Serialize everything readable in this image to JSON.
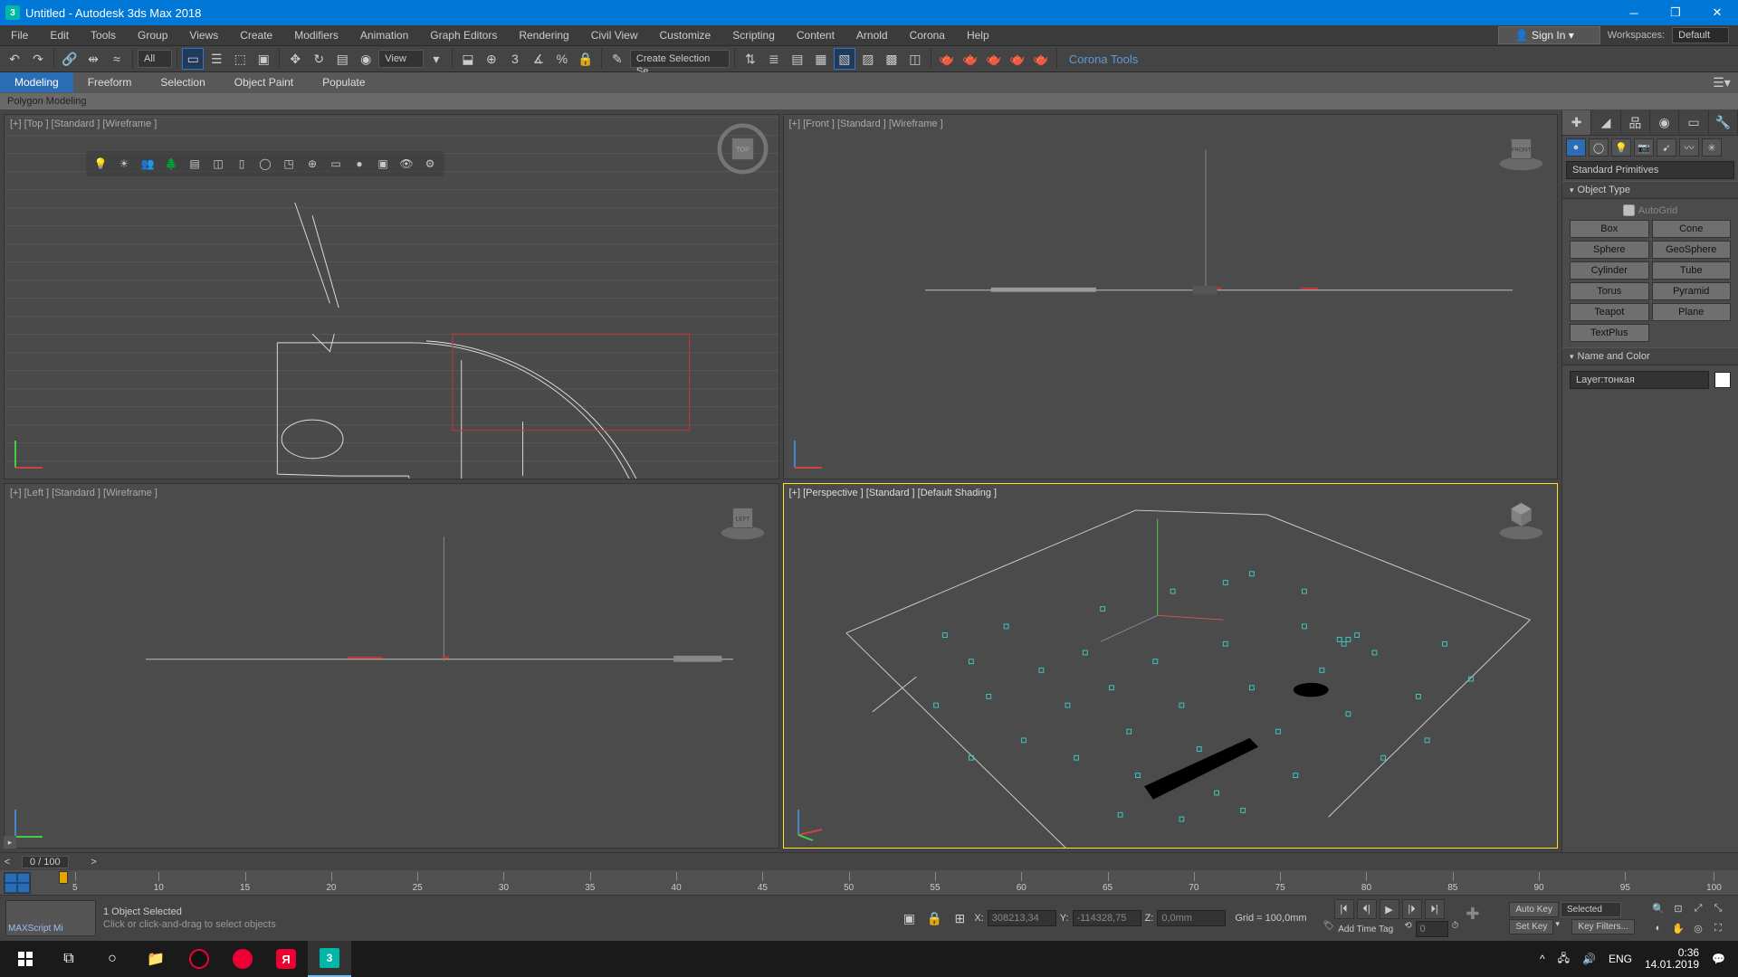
{
  "titlebar": {
    "title": "Untitled - Autodesk 3ds Max 2018"
  },
  "menu": [
    "File",
    "Edit",
    "Tools",
    "Group",
    "Views",
    "Create",
    "Modifiers",
    "Animation",
    "Graph Editors",
    "Rendering",
    "Civil View",
    "Customize",
    "Scripting",
    "Content",
    "Arnold",
    "Corona",
    "Help"
  ],
  "signin": "Sign In",
  "workspace": {
    "label": "Workspaces:",
    "value": "Default"
  },
  "toolbar": {
    "filter_all": "All",
    "view": "View",
    "create_sel": "Create Selection Se",
    "corona": "Corona Tools"
  },
  "ribbon": {
    "tabs": [
      "Modeling",
      "Freeform",
      "Selection",
      "Object Paint",
      "Populate"
    ],
    "sub": "Polygon Modeling"
  },
  "viewports": {
    "tl": "[+] [Top ] [Standard ] [Wireframe ]",
    "tr": "[+] [Front ] [Standard ] [Wireframe ]",
    "bl": "[+] [Left ] [Standard ] [Wireframe ]",
    "br": "[+] [Perspective ] [Standard ] [Default Shading ]"
  },
  "cmdpanel": {
    "category": "Standard Primitives",
    "rollout1": "Object Type",
    "autogrid": "AutoGrid",
    "objects": [
      "Box",
      "Cone",
      "Sphere",
      "GeoSphere",
      "Cylinder",
      "Tube",
      "Torus",
      "Pyramid",
      "Teapot",
      "Plane",
      "TextPlus"
    ],
    "rollout2": "Name and Color",
    "name_value": "Layer:тонкая"
  },
  "time": {
    "frame": "0 / 100",
    "marks": [
      5,
      10,
      15,
      20,
      25,
      30,
      35,
      40,
      45,
      50,
      55,
      60,
      65,
      70,
      75,
      80,
      85,
      90,
      95,
      100
    ]
  },
  "status": {
    "sel": "1 Object Selected",
    "hint": "Click or click-and-drag to select objects",
    "mx": "MAXScript Mi",
    "x": "308213,34",
    "y": "-114328,75",
    "z": "0,0mm",
    "grid": "Grid = 100,0mm",
    "addtag": "Add Time Tag",
    "autokey": "Auto Key",
    "setkey": "Set Key",
    "selected": "Selected",
    "keyfilt": "Key Filters...",
    "xl": "X:",
    "yl": "Y:",
    "zl": "Z:"
  },
  "tray": {
    "lang": "ENG",
    "time": "0:36",
    "date": "14.01.2019"
  }
}
